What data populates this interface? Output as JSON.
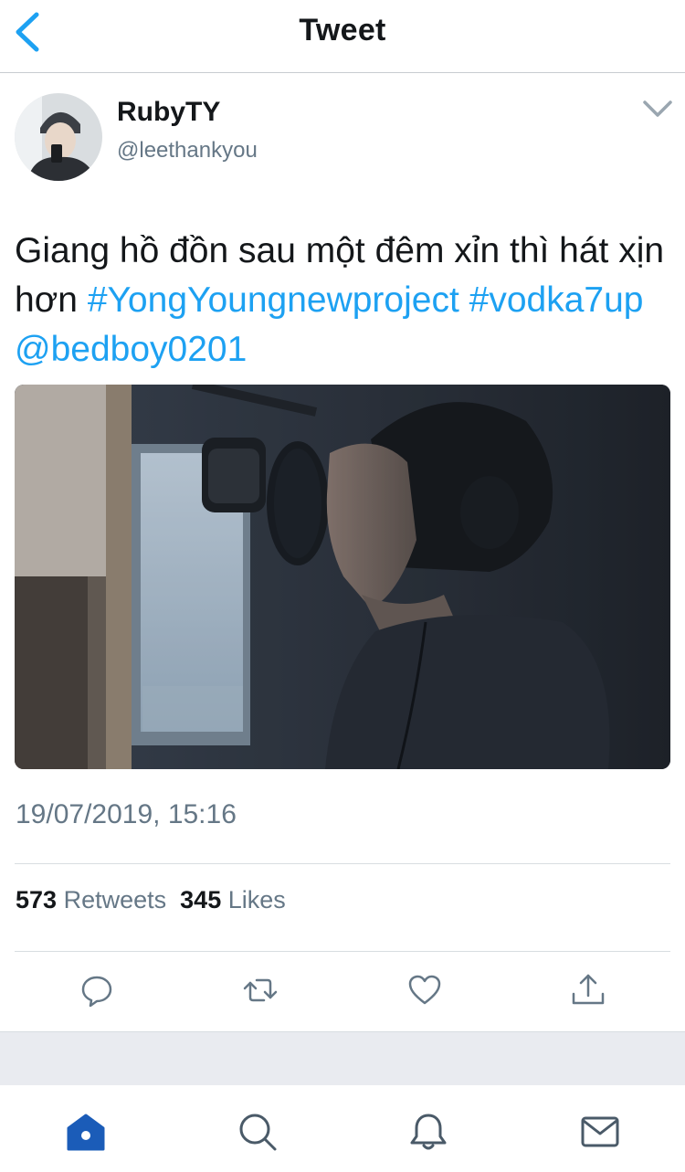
{
  "nav": {
    "title": "Tweet",
    "back_icon": "chevron-left-icon"
  },
  "author": {
    "display_name": "RubyTY",
    "handle": "@leethankyou"
  },
  "tweet": {
    "text_plain": "Giang hồ đồn sau một đêm xỉn thì hát xịn hơn",
    "hashtag_1": "#YongYoungnewproject",
    "hashtag_2": "#vodka7up",
    "mention": "@bedboy0201",
    "timestamp": "19/07/2019, 15:16"
  },
  "stats": {
    "retweets_count": "573",
    "retweets_label": "Retweets",
    "likes_count": "345",
    "likes_label": "Likes"
  },
  "actions": [
    "reply-icon",
    "retweet-icon",
    "like-icon",
    "share-icon"
  ],
  "tabbar": [
    "home-icon",
    "search-icon",
    "notifications-icon",
    "messages-icon"
  ],
  "colors": {
    "accent": "#1da1f2",
    "text": "#14171a",
    "secondary": "#657786",
    "tab_active": "#1b5cb8",
    "icon_gray": "#657786"
  }
}
